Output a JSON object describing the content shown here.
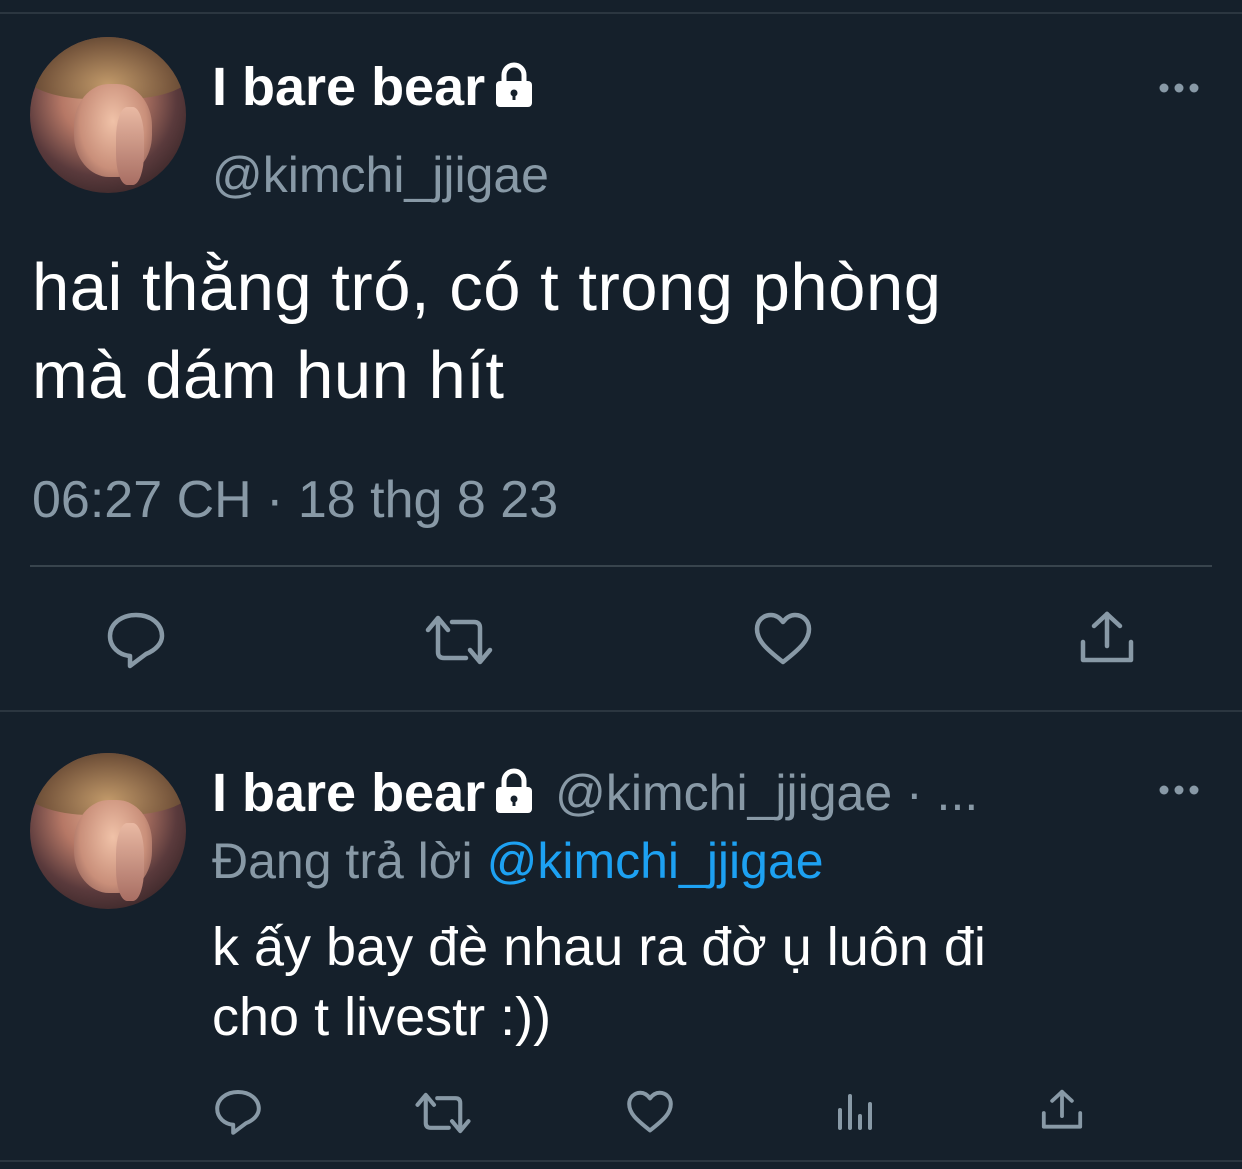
{
  "main_tweet": {
    "display_name": "I bare bear",
    "handle": "@kimchi_jjigae",
    "text_line1": "hai thằng tró, có t trong phòng",
    "text_line2": "mà dám hun hít",
    "timestamp": "06:27 CH · 18 thg 8 23",
    "more_label": "More options"
  },
  "reply_tweet": {
    "display_name": "I bare bear",
    "handle_with_dot": "@kimchi_jjigae · ...",
    "replying_prefix": "Đang trả lời",
    "replying_mention": "@kimchi_jjigae",
    "text_line1": "k ấy bay đè nhau ra đờ ụ luôn đi",
    "text_line2": "cho t livestr :))"
  },
  "icons": {
    "lock": "lock-icon",
    "more": "more-icon",
    "reply": "reply-icon",
    "retweet": "retweet-icon",
    "like": "heart-icon",
    "analytics": "analytics-icon",
    "share": "share-icon"
  },
  "colors": {
    "background": "#15202b",
    "secondary_text": "#8899a6",
    "divider": "#38444d",
    "mention": "#1da1f2",
    "primary_text": "#ffffff"
  }
}
